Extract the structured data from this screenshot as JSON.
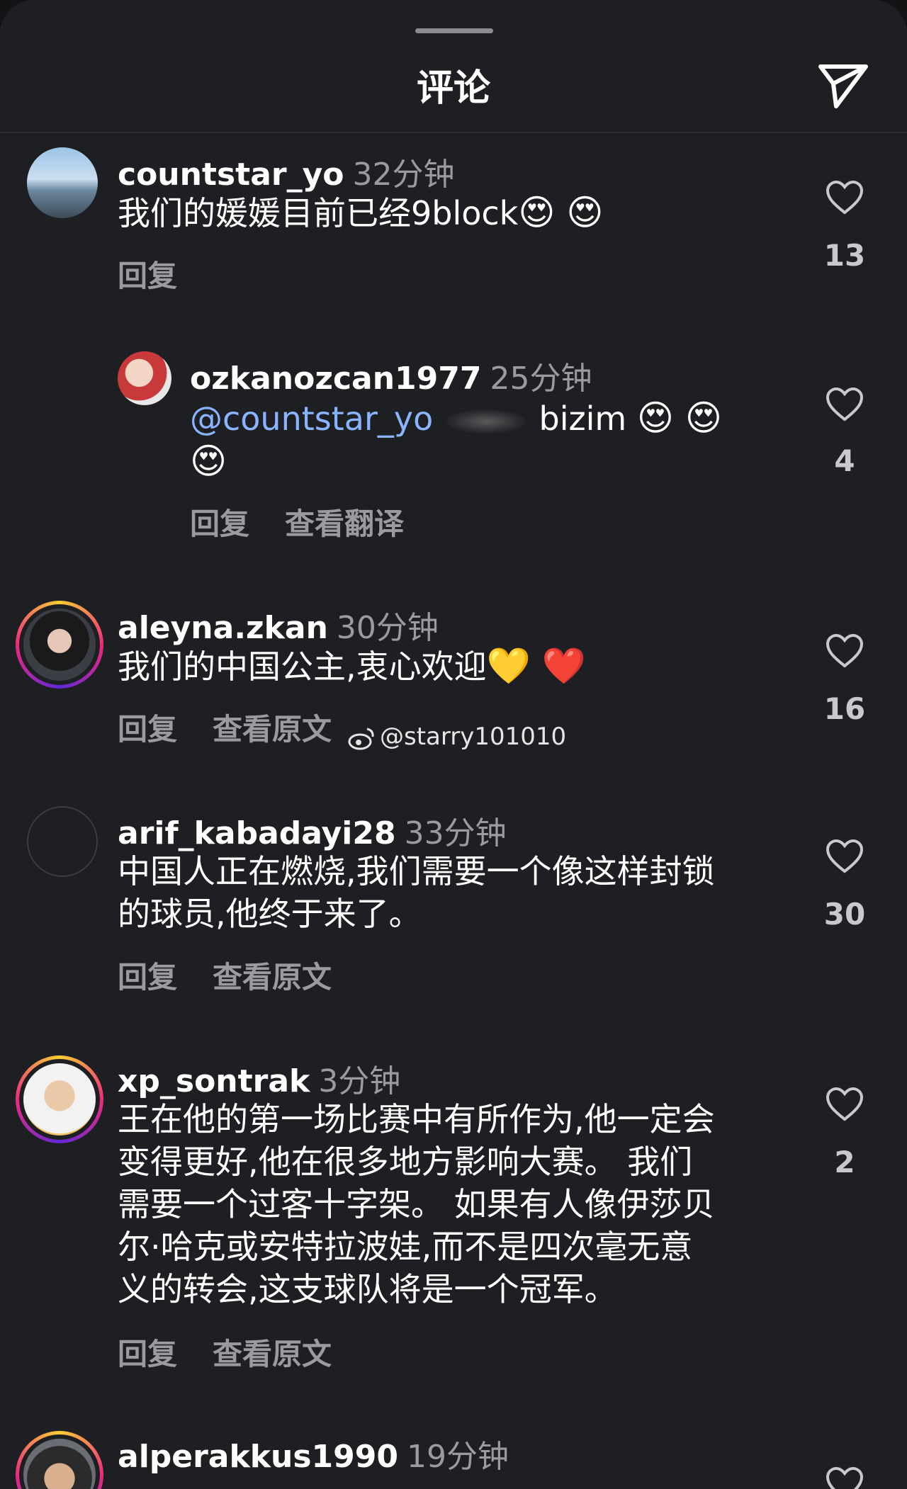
{
  "header": {
    "title": "评论"
  },
  "colors": {
    "background": "#1e1f22",
    "mention": "#8ab4ff",
    "muted": "#9a9ba0"
  },
  "comments": [
    {
      "username": "countstar_yo",
      "time": "32分钟",
      "text": "我们的媛媛目前已经9block",
      "emojis": "😍 😍",
      "actions": [
        "回复"
      ],
      "likes": "13"
    },
    {
      "username": "ozkanozcan1977",
      "time": "25分钟",
      "mention": "@countstar_yo",
      "text": "bizim",
      "emojis": "😍 😍",
      "emojis2": "😍",
      "actions": [
        "回复",
        "查看翻译"
      ],
      "likes": "4"
    },
    {
      "username": "aleyna.zkan",
      "time": "30分钟",
      "text": "我们的中国公主,衷心欢迎",
      "emojis": "💛 ❤️",
      "actions": [
        "回复",
        "查看原文"
      ],
      "likes": "16"
    },
    {
      "username": "arif_kabadayi28",
      "time": "33分钟",
      "text_lines": [
        "中国人正在燃烧,我们需要一个像这样封锁",
        "的球员,他终于来了。"
      ],
      "actions": [
        "回复",
        "查看原文"
      ],
      "likes": "30"
    },
    {
      "username": "xp_sontrak",
      "time": "3分钟",
      "text_lines": [
        "王在他的第一场比赛中有所作为,他一定会",
        "变得更好,他在很多地方影响大赛。 我们",
        "需要一个过客十字架。 如果有人像伊莎贝",
        "尔·哈克或安特拉波娃,而不是四次毫无意",
        "义的转会,这支球队将是一个冠军。"
      ],
      "actions": [
        "回复",
        "查看原文"
      ],
      "likes": "2"
    },
    {
      "username": "alperakkus1990",
      "time": "19分钟"
    }
  ],
  "watermark": "@starry101010"
}
